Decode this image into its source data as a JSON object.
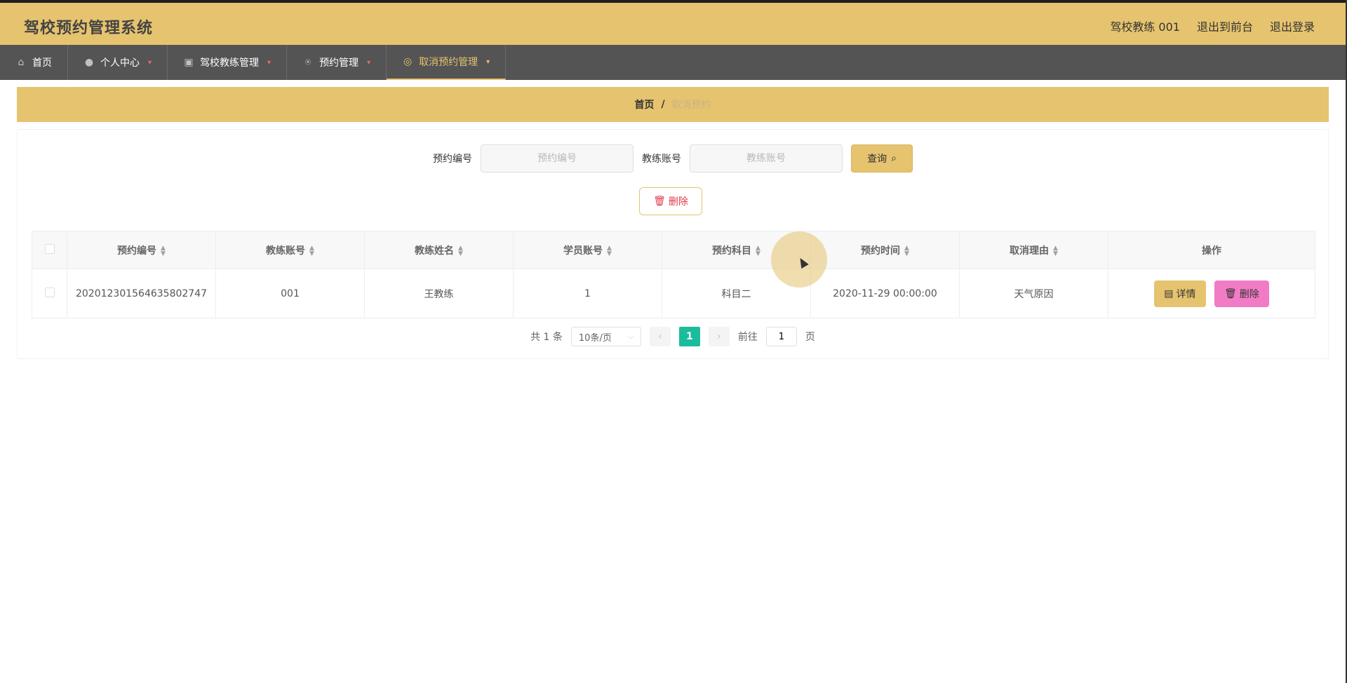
{
  "app": {
    "title": "驾校预约管理系统",
    "top_right": {
      "user": "驾校教练 001",
      "to_frontend": "退出到前台",
      "logout": "退出登录"
    }
  },
  "nav": {
    "items": [
      {
        "label": "首页",
        "icon": "home-icon"
      },
      {
        "label": "个人中心",
        "icon": "user-icon"
      },
      {
        "label": "驾校教练管理",
        "icon": "chart-icon"
      },
      {
        "label": "预约管理",
        "icon": "microphone-icon"
      },
      {
        "label": "取消预约管理",
        "icon": "circle-icon",
        "active": true
      }
    ]
  },
  "breadcrumb": {
    "home": "首页",
    "separator": "/",
    "current": "取消预约"
  },
  "search": {
    "field1_label": "预约编号",
    "field1_placeholder": "预约编号",
    "field2_label": "教练账号",
    "field2_placeholder": "教练账号",
    "query_label": "查询"
  },
  "toolbar": {
    "delete_label": "删除"
  },
  "table": {
    "columns": [
      "预约编号",
      "教练账号",
      "教练姓名",
      "学员账号",
      "预约科目",
      "预约时间",
      "取消理由",
      "操作"
    ],
    "rows": [
      {
        "cells": [
          "202012301564635802747",
          "001",
          "王教练",
          "1",
          "科目二",
          "2020-11-29 00:00:00",
          "天气原因"
        ],
        "detail_label": "详情",
        "delete_label": "删除"
      }
    ]
  },
  "pager": {
    "total": "共 1 条",
    "page_size": "10条/页",
    "current_page": "1",
    "goto_prefix": "前往",
    "goto_value": "1",
    "goto_suffix": "页"
  },
  "colors": {
    "accent": "#e6c36e",
    "nav_bg": "#545454",
    "page_active": "#1abc9c",
    "delete_pink": "#f27bc5"
  }
}
